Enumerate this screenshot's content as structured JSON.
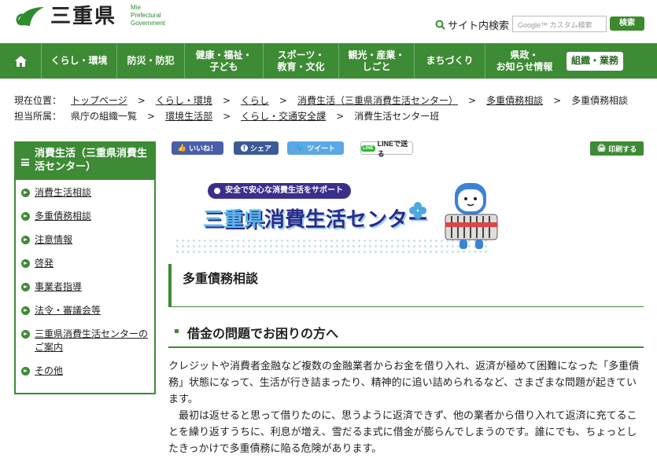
{
  "header": {
    "logo_name": "三重県",
    "logo_en": [
      "Mie",
      "Prefectural",
      "Government"
    ],
    "search_label": "サイト内検索",
    "search_placeholder": "Google™ カスタム検索",
    "search_button": "検索"
  },
  "nav": {
    "home_icon": "home-icon",
    "items": [
      {
        "label": "くらし・環境"
      },
      {
        "label": "防災・防犯"
      },
      {
        "label": "健康・福祉・\n子ども"
      },
      {
        "label": "スポーツ・\n教育・文化"
      },
      {
        "label": "観光・産業・\nしごと"
      },
      {
        "label": "まちづくり"
      },
      {
        "label": "県政・\nお知らせ情報"
      },
      {
        "label": "組織・業務"
      }
    ]
  },
  "breadcrumb": {
    "location_label": "現在位置：",
    "location": [
      "トップページ",
      "くらし・環境",
      "くらし",
      "消費生活（三重県消費生活センター）",
      "多重債務相談"
    ],
    "current": "多重債務相談",
    "dept_label": "担当所属：",
    "dept": [
      "県庁の組織一覧",
      "環境生活部",
      "くらし・交通安全課"
    ],
    "dept_current": "消費生活センター班"
  },
  "sidebar": {
    "title": "消費生活（三重県消費生活センター）",
    "items": [
      {
        "label": "消費生活相談"
      },
      {
        "label": "多重債務相談"
      },
      {
        "label": "注意情報"
      },
      {
        "label": "啓発"
      },
      {
        "label": "事業者指導"
      },
      {
        "label": "法令・審議会等"
      },
      {
        "label": "三重県消費生活センターのご案内"
      },
      {
        "label": "その他"
      }
    ]
  },
  "social": {
    "like": "いいね！",
    "share": "シェア",
    "tweet": "ツイート",
    "line": "LINEで送る",
    "print": "印刷する"
  },
  "banner": {
    "tagline": "安全で安心な消費生活をサポート",
    "title_pref": "三重県",
    "title_rest": "消費生活センター"
  },
  "main": {
    "page_title": "多重債務相談",
    "section_title": "借金の問題でお困りの方へ",
    "paragraphs": [
      "クレジットや消費者金融など複数の金融業者からお金を借り入れ、返済が極めて困難になった「多重債務」状態になって、生活が行き詰まったり、精神的に追い詰められるなど、さまざまな問題が起きています。",
      "最初は返せると思って借りたのに、思うように返済できず、他の業者から借り入れて返済に充てることを繰り返すうちに、利息が増え、雪だるま式に借金が膨らんでしまうのです。誰にでも、ちょっとしたきっかけで多重債務に陥る危険があります。"
    ]
  },
  "colors": {
    "green": "#3d8b34",
    "navy": "#2d2a8a",
    "light_blue": "#5bb8ea"
  }
}
